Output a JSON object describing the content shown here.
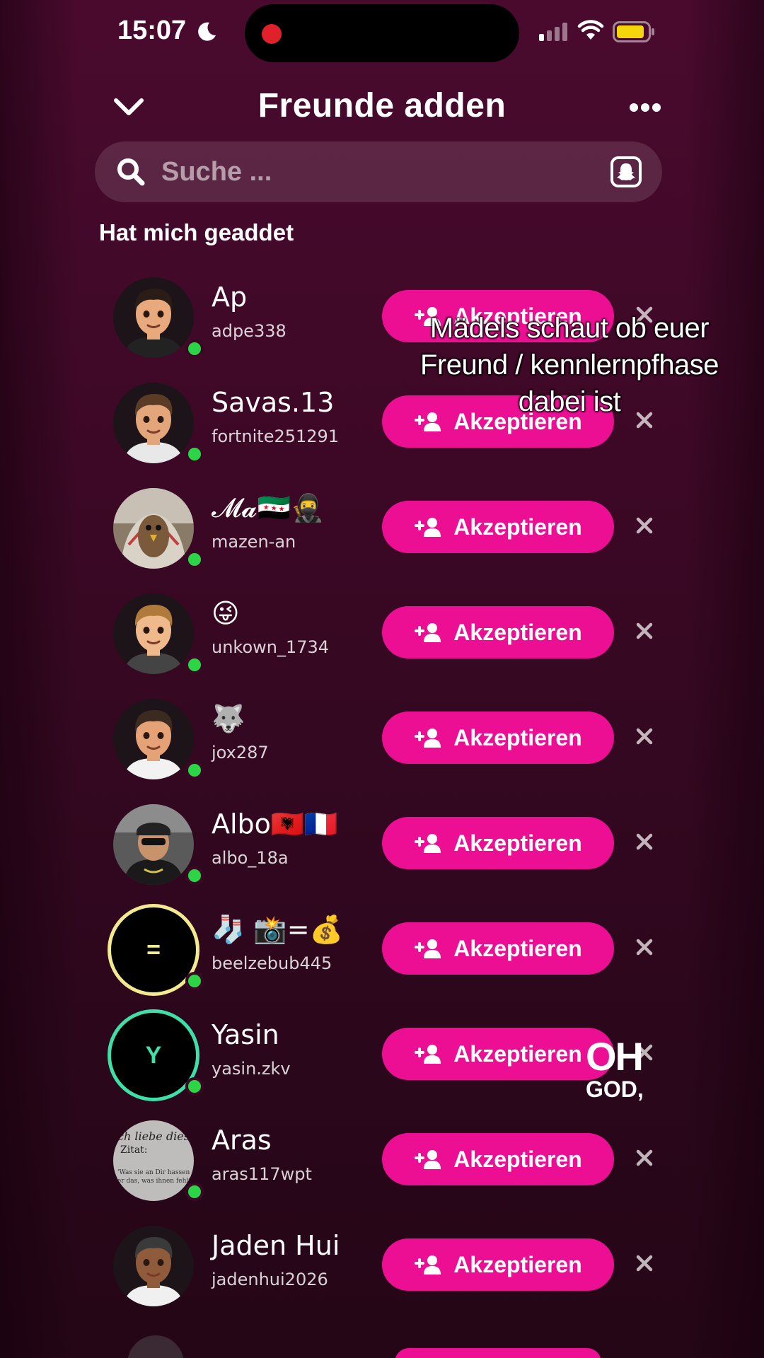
{
  "status_bar": {
    "time": "15:07"
  },
  "header": {
    "title": "Freunde adden"
  },
  "search": {
    "placeholder": "Suche ..."
  },
  "section_title": "Hat mich geaddet",
  "accept_label": "Akzeptieren",
  "colors": {
    "accent": "#ec0f93",
    "online": "#2bd546",
    "background": "#3a0824"
  },
  "friends": [
    {
      "name": "Ap",
      "username": "adpe338",
      "avatar": "bitmoji",
      "online": true
    },
    {
      "name": "Savas.13",
      "username": "fortnite251291",
      "avatar": "bitmoji",
      "online": true
    },
    {
      "name": "𝓜𝓪🇸🇾🥷",
      "username": "mazen-an",
      "avatar": "photo-falcon",
      "online": true
    },
    {
      "name": "😜",
      "username": "unkown_1734",
      "avatar": "bitmoji",
      "online": true
    },
    {
      "name": "🐺",
      "username": "jox287",
      "avatar": "bitmoji",
      "online": true
    },
    {
      "name": "Albo🇦🇱🇫🇷",
      "username": "albo_18a",
      "avatar": "photo",
      "online": true
    },
    {
      "name": "🧦 📸=💰",
      "username": "beelzebub445",
      "avatar": "initial",
      "initial": "=",
      "online": true
    },
    {
      "name": "Yasin",
      "username": "yasin.zkv",
      "avatar": "initial",
      "initial": "Y",
      "online": true
    },
    {
      "name": "Aras",
      "username": "aras117wpt",
      "avatar": "photo-quote",
      "online": true
    },
    {
      "name": "Jaden Hui",
      "username": "jadenhui2026",
      "avatar": "bitmoji",
      "online": false
    }
  ],
  "overlay": {
    "caption": "Mädels schaut ob euer Freund / kennlernpfhase dabei ist",
    "sticker_line1": "OH",
    "sticker_line2": "GOD,"
  }
}
